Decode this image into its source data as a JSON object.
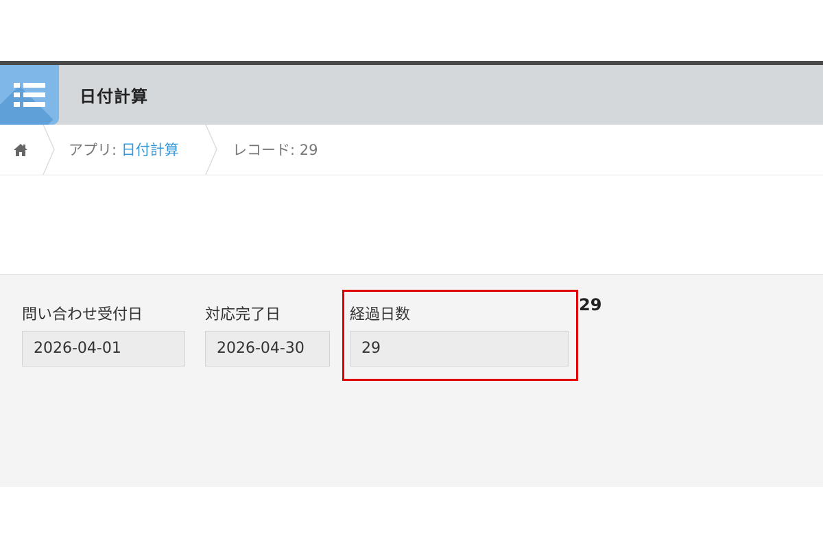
{
  "header": {
    "app_title": "日付計算",
    "app_icon": "list-icon",
    "icon_color": "#7fb8e8"
  },
  "breadcrumb": {
    "home_icon": "home-icon",
    "app_prefix": "アプリ: ",
    "app_name": "日付計算",
    "record_label": "レコード: 29"
  },
  "form": {
    "fields": [
      {
        "label": "問い合わせ受付日",
        "value": "2026-04-01"
      },
      {
        "label": "対応完了日",
        "value": "2026-04-30"
      },
      {
        "label": "経過日数",
        "value": "29"
      }
    ],
    "annotation": "29",
    "highlight_color": "#e00000"
  }
}
